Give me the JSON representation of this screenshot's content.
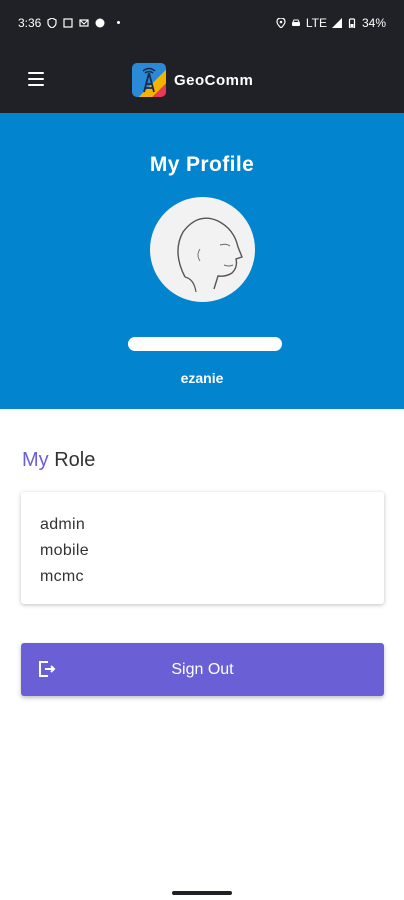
{
  "status_bar": {
    "time": "3:36",
    "network": "LTE",
    "battery": "34%"
  },
  "app_bar": {
    "menu_icon": "hamburger-menu-icon",
    "brand_name": "GeoComm",
    "logo_icon": "cell-tower-logo-icon"
  },
  "profile": {
    "title": "My Profile",
    "avatar_icon": "person-sketch-avatar",
    "username": "ezanie"
  },
  "role_section": {
    "heading_prefix": "My",
    "heading_suffix": " Role",
    "roles": [
      "admin",
      "mobile",
      "mcmc"
    ]
  },
  "signout": {
    "label": "Sign Out",
    "icon": "logout-icon"
  },
  "colors": {
    "header_dark": "#1f2126",
    "profile_blue": "#0384cf",
    "accent_purple": "#6a5fd4"
  }
}
